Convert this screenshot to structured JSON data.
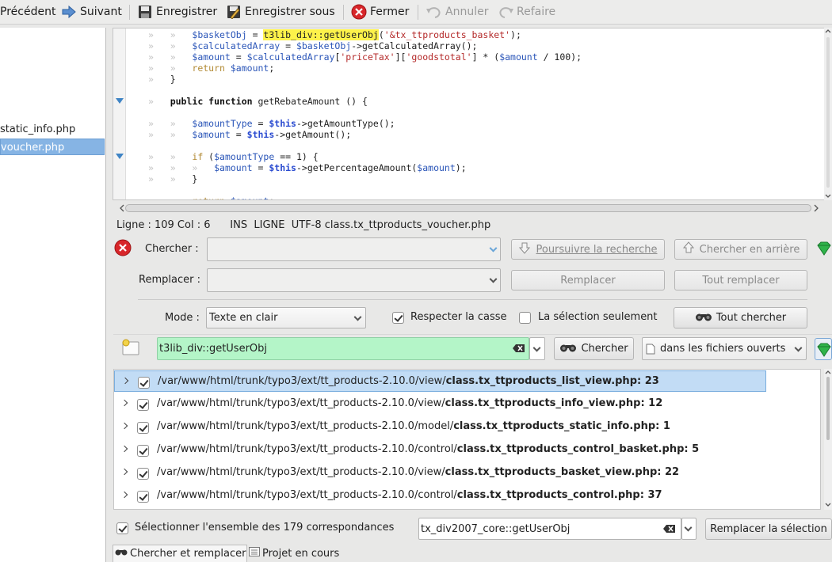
{
  "toolbar": {
    "previous": "Précédent",
    "next": "Suivant",
    "save": "Enregistrer",
    "save_as": "Enregistrer sous",
    "close": "Fermer",
    "undo": "Annuler",
    "redo": "Refaire"
  },
  "files": [
    {
      "name": "static_info.php",
      "selected": false
    },
    {
      "name": "voucher.php",
      "selected": true
    }
  ],
  "status": {
    "line_col": "Ligne : 109 Col : 6",
    "ins": "INS",
    "ligne": "LIGNE",
    "encoding": "UTF-8",
    "filename": "class.tx_ttproducts_voucher.php"
  },
  "find": {
    "search_label": "Chercher :",
    "replace_label": "Remplacer :",
    "search_value": "",
    "replace_value": "",
    "find_next": "Poursuivre la recherche",
    "find_prev": "Chercher en arrière",
    "replace": "Remplacer",
    "replace_all": "Tout remplacer",
    "mode_label": "Mode :",
    "mode_value": "Texte en clair",
    "match_case": "Respecter la casse",
    "match_case_checked": true,
    "selection_only": "La sélection seulement",
    "selection_only_checked": false,
    "find_all": "Tout chercher"
  },
  "files_search": {
    "value": "t3lib_div::getUserObj",
    "search_button": "Chercher",
    "scope": "dans les fichiers ouverts"
  },
  "results": [
    {
      "dir": "/var/www/html/trunk/typo3/ext/tt_products-2.10.0/view/",
      "file": "class.tx_ttproducts_list_view.php",
      "count": ": 23",
      "selected": true
    },
    {
      "dir": "/var/www/html/trunk/typo3/ext/tt_products-2.10.0/view/",
      "file": "class.tx_ttproducts_info_view.php",
      "count": ": 12",
      "selected": false
    },
    {
      "dir": "/var/www/html/trunk/typo3/ext/tt_products-2.10.0/model/",
      "file": "class.tx_ttproducts_static_info.php",
      "count": ": 1",
      "selected": false
    },
    {
      "dir": "/var/www/html/trunk/typo3/ext/tt_products-2.10.0/control/",
      "file": "class.tx_ttproducts_control_basket.php",
      "count": ": 5",
      "selected": false
    },
    {
      "dir": "/var/www/html/trunk/typo3/ext/tt_products-2.10.0/view/",
      "file": "class.tx_ttproducts_basket_view.php",
      "count": ": 22",
      "selected": false
    },
    {
      "dir": "/var/www/html/trunk/typo3/ext/tt_products-2.10.0/control/",
      "file": "class.tx_ttproducts_control.php",
      "count": ": 37",
      "selected": false
    }
  ],
  "bottom": {
    "select_all": "Sélectionner l'ensemble des 179 correspondances",
    "replace_value": "tx_div2007_core::getUserObj",
    "replace_selection": "Remplacer la sélection"
  },
  "tabs": {
    "find_replace": "Chercher et remplacer",
    "project": "Projet en cours"
  },
  "colors": {
    "search_bg": "#b4f5c8",
    "selection": "#86b4e4",
    "highlight": "#fdf24a"
  }
}
